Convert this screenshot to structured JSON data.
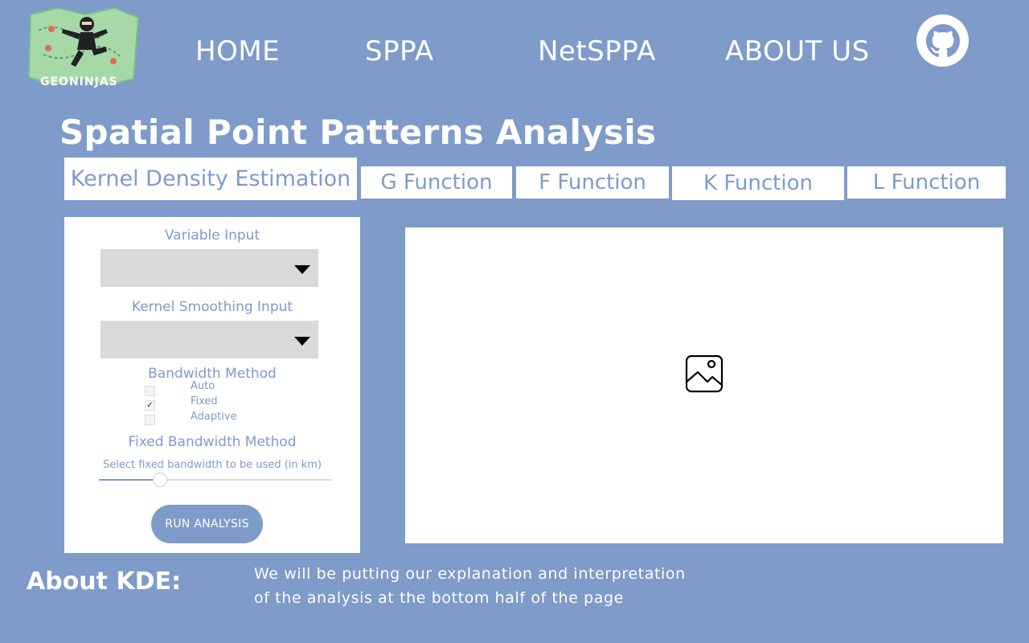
{
  "header": {
    "logo_text": "GEONINJAS",
    "nav": [
      "HOME",
      "SPPA",
      "NetSPPA",
      "ABOUT US"
    ],
    "github_icon": "github-icon"
  },
  "page": {
    "title": "Spatial Point Patterns Analysis"
  },
  "tabs": [
    {
      "label": "Kernel Density Estimation",
      "active": true
    },
    {
      "label": "G Function",
      "active": false
    },
    {
      "label": "F Function",
      "active": false
    },
    {
      "label": "K Function",
      "active": false
    },
    {
      "label": "L Function",
      "active": false
    }
  ],
  "panel": {
    "variable_input_label": "Variable Input",
    "variable_input_value": "",
    "kernel_input_label": "Kernel Smoothing Input",
    "kernel_input_value": "",
    "bandwidth_method_label": "Bandwidth Method",
    "bandwidth_options": [
      {
        "label": "Auto",
        "checked": false
      },
      {
        "label": "Fixed",
        "checked": true
      },
      {
        "label": "Adaptive",
        "checked": false
      }
    ],
    "fixed_bandwidth_label": "Fixed Bandwidth Method",
    "slider_label": "Select fixed bandwidth to be used (in km)",
    "slider_fraction": 0.26,
    "run_button": "RUN ANALYSIS"
  },
  "output": {
    "placeholder_icon": "image-placeholder-icon"
  },
  "about": {
    "title": "About KDE:",
    "line1": "We will be putting our explanation and interpretation",
    "line2": "of the analysis at the bottom half of the page"
  },
  "colors": {
    "background": "#7e9bc9",
    "accent": "#7e9bc9",
    "panel": "#ffffff",
    "select_bg": "#d9d9d9"
  }
}
